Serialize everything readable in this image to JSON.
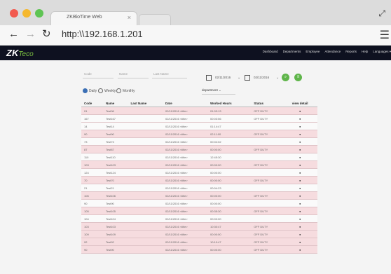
{
  "browser": {
    "tab_title": "ZKBioTime Web",
    "tab_close": "×",
    "address": "http:\\\\192.168.1.201"
  },
  "app": {
    "logo_main": "ZK",
    "logo_sub": "Teco",
    "nav": [
      "Dashboard",
      "Departments",
      "Employee",
      "Attendance",
      "Reports",
      "Help",
      "Languages ▾"
    ]
  },
  "filters": {
    "code_placeholder": "Code",
    "name_placeholder": "Name",
    "lastname_placeholder": "Last Name",
    "date_from": "02/11/2016",
    "date_to": "02/11/2016",
    "radio": [
      {
        "label": "Daily",
        "checked": true
      },
      {
        "label": "Weekly",
        "checked": false
      },
      {
        "label": "Monthly",
        "checked": false
      }
    ],
    "department": "department"
  },
  "table": {
    "headers": [
      "Code",
      "Name",
      "Last Name",
      "Date",
      "Worked Hours",
      "Status",
      "view detail"
    ],
    "rows": [
      {
        "code": "01",
        "name": "Test06",
        "last": "",
        "date": "02/11/2016 <title>",
        "hours": "01:03:13",
        "status": "OFF DUTY",
        "pink": true
      },
      {
        "code": "167",
        "name": "Test167",
        "last": "",
        "date": "02/11/2016 <title>",
        "hours": "00:03:56",
        "status": "OFF DUTY",
        "pink": false
      },
      {
        "code": "14",
        "name": "Test14",
        "last": "",
        "date": "02/11/2016 <title>",
        "hours": "01:14:47",
        "status": "",
        "pink": false
      },
      {
        "code": "90",
        "name": "Test90",
        "last": "",
        "date": "02/11/2016 <title>",
        "hours": "02:11:00",
        "status": "OFF DUTY",
        "pink": true
      },
      {
        "code": "73",
        "name": "Test73",
        "last": "",
        "date": "02/11/2016 <title>",
        "hours": "00:04:02",
        "status": "",
        "pink": false
      },
      {
        "code": "87",
        "name": "Test87",
        "last": "",
        "date": "02/11/2016 <title>",
        "hours": "00:00:00",
        "status": "OFF DUTY",
        "pink": true
      },
      {
        "code": "110",
        "name": "Test110",
        "last": "",
        "date": "02/11/2016 <title>",
        "hours": "12:45:30",
        "status": "",
        "pink": false
      },
      {
        "code": "103",
        "name": "Test103",
        "last": "",
        "date": "02/11/2016 <title>",
        "hours": "00:00:00",
        "status": "OFF DUTY",
        "pink": true
      },
      {
        "code": "124",
        "name": "Test124",
        "last": "",
        "date": "02/11/2016 <title>",
        "hours": "00:00:00",
        "status": "",
        "pink": false
      },
      {
        "code": "70",
        "name": "Test70",
        "last": "",
        "date": "02/11/2016 <title>",
        "hours": "00:00:00",
        "status": "OFF DUTY",
        "pink": true
      },
      {
        "code": "21",
        "name": "Test21",
        "last": "",
        "date": "02/11/2016 <title>",
        "hours": "00:04:23",
        "status": "",
        "pink": false
      },
      {
        "code": "106",
        "name": "Test106",
        "last": "",
        "date": "02/11/2016 <title>",
        "hours": "00:00:00",
        "status": "OFF DUTY",
        "pink": true
      },
      {
        "code": "90",
        "name": "Test90",
        "last": "",
        "date": "02/11/2016 <title>",
        "hours": "00:00:00",
        "status": "",
        "pink": false
      },
      {
        "code": "105",
        "name": "Test105",
        "last": "",
        "date": "02/11/2016 <title>",
        "hours": "00:35:30",
        "status": "OFF DUTY",
        "pink": true
      },
      {
        "code": "104",
        "name": "Test104",
        "last": "",
        "date": "02/11/2016 <title>",
        "hours": "00:00:00",
        "status": "",
        "pink": false
      },
      {
        "code": "103",
        "name": "Test103",
        "last": "",
        "date": "02/11/2016 <title>",
        "hours": "10:30:47",
        "status": "OFF DUTY",
        "pink": true
      },
      {
        "code": "109",
        "name": "Test109",
        "last": "",
        "date": "02/11/2016 <title>",
        "hours": "00:00:00",
        "status": "OFF DUTY",
        "pink": true
      },
      {
        "code": "92",
        "name": "Test92",
        "last": "",
        "date": "02/11/2016 <title>",
        "hours": "10:10:47",
        "status": "OFF DUTY",
        "pink": true
      },
      {
        "code": "90",
        "name": "Test90",
        "last": "",
        "date": "02/11/2016 <title>",
        "hours": "00:00:00",
        "status": "OFF DUTY",
        "pink": true
      }
    ]
  },
  "colors": {
    "appbar_bg": "#0e1120",
    "accent_green": "#5fb54a",
    "row_pink": "#f6dcdf"
  }
}
